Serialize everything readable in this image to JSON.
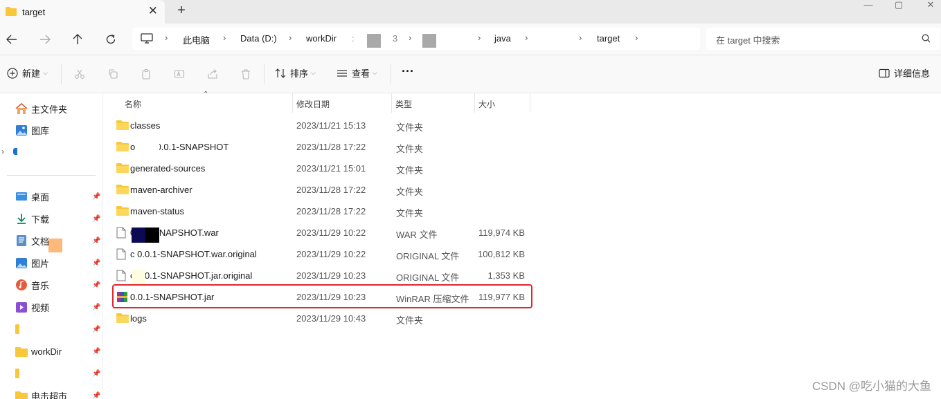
{
  "window": {
    "tab_title": "target",
    "tab_close": "✕",
    "new_tab": "+",
    "minimize": "—",
    "maximize": "▢",
    "close": "✕"
  },
  "breadcrumbs": [
    {
      "label": "此电脑"
    },
    {
      "label": "Data (D:)"
    },
    {
      "label": "workDir"
    },
    {
      "label": ":"
    },
    {
      "label": "3"
    },
    {
      "label": "java"
    },
    {
      "label": "target"
    }
  ],
  "search": {
    "placeholder": "在 target 中搜索"
  },
  "commands": {
    "new_label": "新建",
    "sort_label": "排序",
    "view_label": "查看",
    "more_label": "···",
    "details_label": "详细信息"
  },
  "sidebar": {
    "top_items": [
      {
        "label": "主文件夹",
        "icon": "home-icon"
      },
      {
        "label": "图库",
        "icon": "gallery-icon"
      }
    ],
    "pinned_items": [
      {
        "label": "桌面",
        "icon": "desktop-icon"
      },
      {
        "label": "下载",
        "icon": "download-icon"
      },
      {
        "label": "文档",
        "icon": "documents-icon"
      },
      {
        "label": "图片",
        "icon": "pictures-icon"
      },
      {
        "label": "音乐",
        "icon": "music-icon"
      },
      {
        "label": "视频",
        "icon": "videos-icon"
      },
      {
        "label": "",
        "icon": "folder-icon"
      },
      {
        "label": "workDir",
        "icon": "folder-icon"
      },
      {
        "label": "",
        "icon": "folder-icon"
      },
      {
        "label": "电击超市",
        "icon": "folder-icon"
      }
    ]
  },
  "columns": {
    "name": "名称",
    "modified": "修改日期",
    "type": "类型",
    "size": "大小"
  },
  "files": [
    {
      "name": "classes",
      "date": "2023/11/21 15:13",
      "type": "文件夹",
      "size": "",
      "icon": "folder"
    },
    {
      "name": "o.lil. 0 0.0.1-SNAPSHOT",
      "date": "2023/11/28 17:22",
      "type": "文件夹",
      "size": "",
      "icon": "folder"
    },
    {
      "name": "generated-sources",
      "date": "2023/11/21 15:01",
      "type": "文件夹",
      "size": "",
      "icon": "folder"
    },
    {
      "name": "maven-archiver",
      "date": "2023/11/28 17:22",
      "type": "文件夹",
      "size": "",
      "icon": "folder"
    },
    {
      "name": "maven-status",
      "date": "2023/11/28 17:22",
      "type": "文件夹",
      "size": "",
      "icon": "folder"
    },
    {
      "name": "0.0.1-SNAPSHOT.war",
      "date": "2023/11/29 10:22",
      "type": "WAR 文件",
      "size": "119,974 KB",
      "icon": "file"
    },
    {
      "name": "c       0.0.1-SNAPSHOT.war.original",
      "date": "2023/11/29 10:22",
      "type": "ORIGINAL 文件",
      "size": "100,812 KB",
      "icon": "file"
    },
    {
      "name": "c       0.0.1-SNAPSHOT.jar.original",
      "date": "2023/11/29 10:23",
      "type": "ORIGINAL 文件",
      "size": "1,353 KB",
      "icon": "file"
    },
    {
      "name": "0.0.1-SNAPSHOT.jar",
      "date": "2023/11/29 10:23",
      "type": "WinRAR 压缩文件",
      "size": "119,977 KB",
      "icon": "winrar"
    },
    {
      "name": "logs",
      "date": "2023/11/29 10:43",
      "type": "文件夹",
      "size": "",
      "icon": "folder"
    }
  ],
  "watermark": "CSDN @吃小猫的大鱼",
  "colors": {
    "highlight_border": "#e0262a",
    "folder_yellow": "#f8c73a",
    "accent_blue": "#0067c0"
  }
}
